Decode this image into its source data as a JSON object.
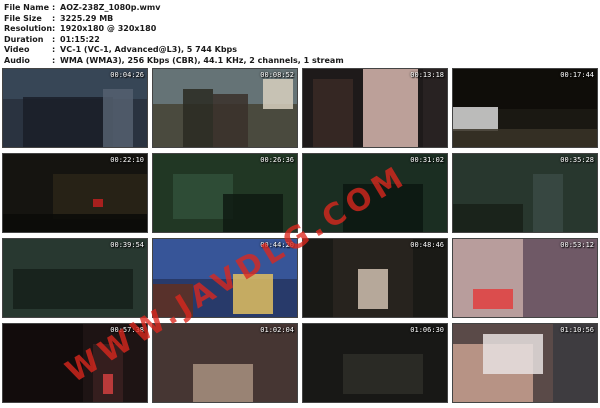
{
  "info": {
    "file_name": {
      "key": "File Name",
      "value": "AOZ-238Z_1080p.wmv"
    },
    "file_size": {
      "key": "File Size",
      "value": "3225.29 MB"
    },
    "resolution": {
      "key": "Resolution",
      "value": "1920x180 @ 320x180"
    },
    "duration": {
      "key": "Duration",
      "value": "01:15:22"
    },
    "video": {
      "key": "Video",
      "value": "VC-1 (VC-1, Advanced@L3), 5 744 Kbps"
    },
    "audio": {
      "key": "Audio",
      "value": "WMA (WMA3), 256 Kbps (CBR), 44.1 KHz, 2 channels, 1 stream"
    },
    "separator": ":"
  },
  "thumbnails": [
    {
      "time": "00:04:26",
      "bg": "#2a3340"
    },
    {
      "time": "00:08:52",
      "bg": "#4a4a3e"
    },
    {
      "time": "00:13:18",
      "bg": "#1e1a1a"
    },
    {
      "time": "00:17:44",
      "bg": "#1a1812"
    },
    {
      "time": "00:22:10",
      "bg": "#151410"
    },
    {
      "time": "00:26:36",
      "bg": "#1a2a1c"
    },
    {
      "time": "00:31:02",
      "bg": "#142218"
    },
    {
      "time": "00:35:28",
      "bg": "#1c2a22"
    },
    {
      "time": "00:39:54",
      "bg": "#1e2e26"
    },
    {
      "time": "00:44:20",
      "bg": "#283a6a"
    },
    {
      "time": "00:48:46",
      "bg": "#1a1a16"
    },
    {
      "time": "00:53:12",
      "bg": "#8a8a86"
    },
    {
      "time": "00:57:38",
      "bg": "#1e1414"
    },
    {
      "time": "01:02:04",
      "bg": "#2e2626"
    },
    {
      "time": "01:06:30",
      "bg": "#101010"
    },
    {
      "time": "01:10:56",
      "bg": "#5a4a48"
    }
  ],
  "watermark": {
    "text": "WWW.JAVDLG.COM",
    "color": "#dc281e"
  }
}
